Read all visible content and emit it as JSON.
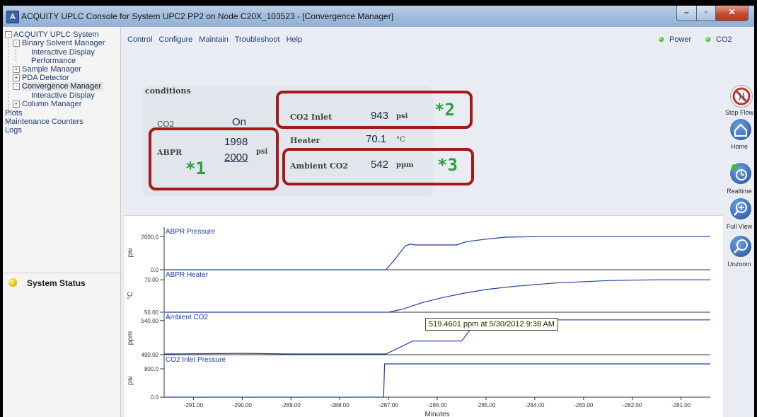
{
  "window": {
    "title": "ACQUITY UPLC Console for System UPC2 PP2 on Node C20X_103523 - [Convergence Manager]",
    "app_icon_glyph": "A"
  },
  "sidebar": {
    "tree": [
      {
        "label": "ACQUITY UPLC System",
        "expander": "-"
      },
      {
        "label": "Binary Solvent Manager",
        "expander": "-"
      },
      {
        "label": "Interactive Display"
      },
      {
        "label": "Performance"
      },
      {
        "label": "Sample Manager",
        "expander": "+"
      },
      {
        "label": "PDA Detector",
        "expander": "+"
      },
      {
        "label": "Convergence Manager",
        "expander": "-"
      },
      {
        "label": "Interactive Display"
      },
      {
        "label": "Column Manager",
        "expander": "+"
      },
      {
        "label": "Plots"
      },
      {
        "label": "Maintenance Counters"
      },
      {
        "label": "Logs"
      }
    ],
    "status_label": "System Status"
  },
  "menu": [
    "Control",
    "Configure",
    "Maintain",
    "Troubleshoot",
    "Help"
  ],
  "indicators": [
    {
      "label": "Power",
      "color": "#35b51e"
    },
    {
      "label": "CO2",
      "color": "#35b51e"
    }
  ],
  "conditions": {
    "title": "conditions",
    "co2": {
      "label": "CO2",
      "value": "On"
    },
    "abpr": {
      "label": "ABPR",
      "actual": "1998",
      "setpoint": "2000",
      "unit": "psi"
    },
    "co2_inlet": {
      "label": "CO2 Inlet",
      "value": "943",
      "unit": "psi"
    },
    "heater": {
      "label": "Heater",
      "value": "70.1",
      "unit": "°C"
    },
    "ambient_co2": {
      "label": "Ambient CO2",
      "value": "542",
      "unit": "ppm"
    }
  },
  "markers": [
    "*1",
    "*2",
    "*3"
  ],
  "highlight_color": "#a31a1a",
  "marker_color": "#2aa040",
  "toolbar": [
    {
      "label": "Stop Flow",
      "icon": "stop-flow-icon"
    },
    {
      "label": "Home",
      "icon": "home-icon"
    },
    {
      "label": "Realtime",
      "icon": "realtime-icon"
    },
    {
      "label": "Full View",
      "icon": "full-view-icon"
    },
    {
      "label": "Unzoom",
      "icon": "unzoom-icon"
    }
  ],
  "tooltip": "519.4601 ppm at 5/30/2012 9:38 AM",
  "chart_data": {
    "type": "line",
    "xlabel": "Minutes",
    "xlim": [
      -291.6,
      -280.4
    ],
    "xticks": [
      -291,
      -290,
      -289,
      -288,
      -287,
      -286,
      -285,
      -284,
      -283,
      -282,
      -281
    ],
    "xtick_labels": [
      "-291.00",
      "-290.00",
      "-289.00",
      "-288.00",
      "-287.00",
      "-286.00",
      "-285.00",
      "-284.00",
      "-283.00",
      "-282.00",
      "-281.00"
    ],
    "line_color": "#1f3da6",
    "panels": [
      {
        "title": "ABPR Pressure",
        "ylabel": "psi",
        "ylim": [
          0,
          2400
        ],
        "yticks": [
          0,
          2000
        ],
        "ytick_labels": [
          "0.0",
          "2000.0"
        ],
        "x": [
          -291.6,
          -287.05,
          -286.85,
          -286.72,
          -286.65,
          -286.55,
          -286.45,
          -286.2,
          -285.6,
          -285.4,
          -285.0,
          -284.6,
          -284.0,
          -283.0,
          -280.4
        ],
        "y": [
          0,
          0,
          700,
          1200,
          1450,
          1550,
          1500,
          1500,
          1500,
          1700,
          1850,
          1970,
          2000,
          2000,
          2000
        ]
      },
      {
        "title": "ABPR Heater",
        "ylabel": "°C",
        "ylim": [
          50,
          74
        ],
        "yticks": [
          50,
          70
        ],
        "ytick_labels": [
          "50.00",
          "70.00"
        ],
        "x": [
          -291.6,
          -287.0,
          -286.7,
          -286.3,
          -285.9,
          -285.4,
          -285.0,
          -284.4,
          -283.6,
          -282.5,
          -281.5,
          -280.4
        ],
        "y": [
          50,
          50,
          52,
          56,
          59,
          62,
          64,
          66,
          68,
          69.5,
          70,
          70
        ]
      },
      {
        "title": "Ambient CO2",
        "ylabel": "ppm",
        "ylim": [
          490,
          547
        ],
        "yticks": [
          490,
          540
        ],
        "ytick_labels": [
          "490.00",
          "540.00"
        ],
        "x": [
          -291.6,
          -290.0,
          -289.0,
          -287.4,
          -287.05,
          -286.5,
          -286.4,
          -285.5,
          -285.3,
          -284.5,
          -280.4
        ],
        "y": [
          491,
          492,
          491,
          491,
          491,
          510,
          510,
          510,
          529,
          541,
          541
        ]
      },
      {
        "title": "CO2 Inlet Pressure",
        "ylabel": "psi",
        "ylim": [
          0,
          1100
        ],
        "yticks": [
          0,
          800
        ],
        "ytick_labels": [
          "0.0",
          "800.0"
        ],
        "x": [
          -291.6,
          -287.1,
          -287.08,
          -280.4
        ],
        "y": [
          0,
          0,
          940,
          940
        ]
      }
    ]
  }
}
